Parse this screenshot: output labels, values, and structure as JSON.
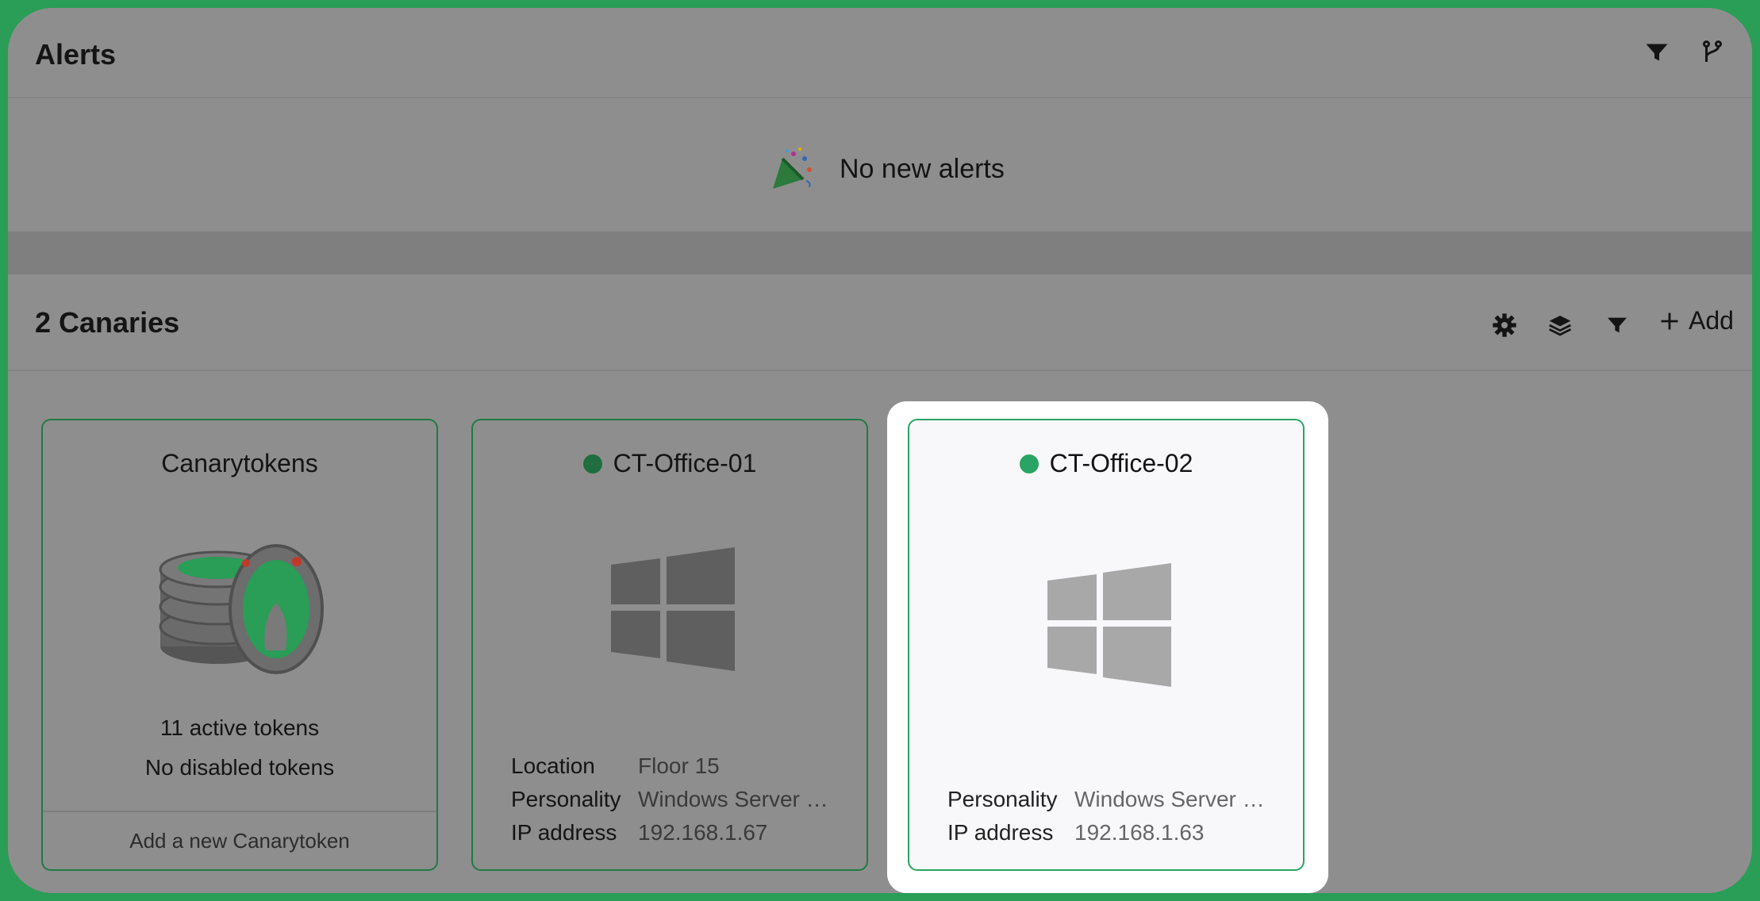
{
  "alerts": {
    "title": "Alerts",
    "empty_message": "No new alerts",
    "icons": [
      "filter-icon",
      "branch-icon"
    ]
  },
  "canaries": {
    "title": "2 Canaries",
    "add_label": "Add",
    "icons": [
      "gear-icon",
      "layers-icon",
      "filter-icon",
      "plus-icon"
    ]
  },
  "cards": {
    "tokens": {
      "title": "Canarytokens",
      "active": "11 active tokens",
      "disabled": "No disabled tokens",
      "footer": "Add a new Canarytoken"
    },
    "office01": {
      "title": "CT-Office-01",
      "status_color": "#1f6e3d",
      "location_label": "Location",
      "location_value": "Floor 15",
      "personality_label": "Personality",
      "personality_value": "Windows Server …",
      "ip_label": "IP address",
      "ip_value": "192.168.1.67"
    },
    "office02": {
      "title": "CT-Office-02",
      "status_color": "#2aa463",
      "personality_label": "Personality",
      "personality_value": "Windows Server …",
      "ip_label": "IP address",
      "ip_value": "192.168.1.63"
    }
  },
  "colors": {
    "frame": "#2a9d57",
    "accent_green": "#2aa463"
  }
}
